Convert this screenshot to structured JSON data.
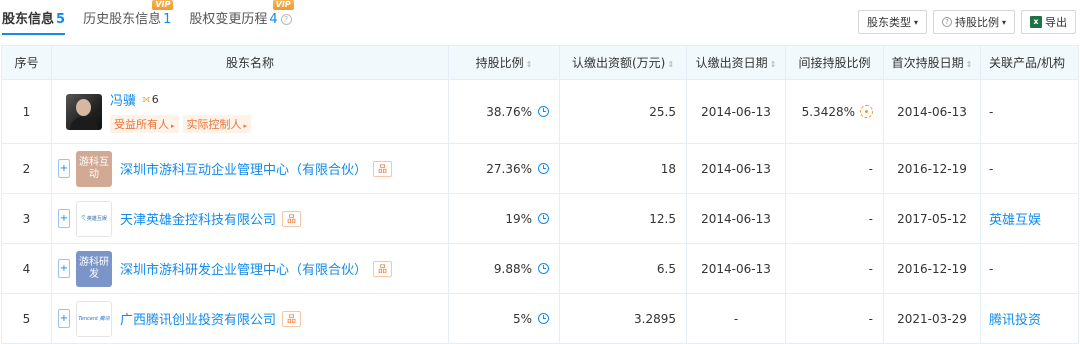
{
  "tabs": [
    {
      "label": "股东信息",
      "count": "5",
      "active": true,
      "vip": ""
    },
    {
      "label": "历史股东信息",
      "count": "1",
      "active": false,
      "vip": "VIP"
    },
    {
      "label": "股权变更历程",
      "count": "4",
      "active": false,
      "vip": "VIP"
    }
  ],
  "help_glyph": "?",
  "actions": {
    "shareholder_type": "股东类型",
    "holding_ratio": "持股比例",
    "export": "导出",
    "caret": "▾",
    "question_glyph": "?",
    "excel_glyph": "x"
  },
  "columns": [
    "序号",
    "股东名称",
    "持股比例",
    "认缴出资额(万元)",
    "认缴出资日期",
    "间接持股比例",
    "首次持股日期",
    "关联产品/机构"
  ],
  "sort_glyph": "⇕",
  "expand_glyph": "+",
  "equity_glyph": "品",
  "tag_arrow": "▸",
  "rows": [
    {
      "index": "1",
      "name": "冯骥",
      "holding_count": "6",
      "holding_glyph": "⟗",
      "tags": [
        "受益所有人",
        "实际控制人"
      ],
      "ratio": "38.76%",
      "amount": "25.5",
      "date": "2014-06-13",
      "indirect": "5.3428%",
      "first_date": "2014-06-13",
      "related": "-"
    },
    {
      "index": "2",
      "name": "深圳市游科互动企业管理中心（有限合伙）",
      "logo_text": "游科互动",
      "ratio": "27.36%",
      "amount": "18",
      "date": "2014-06-13",
      "indirect": "-",
      "first_date": "2016-12-19",
      "related": "-"
    },
    {
      "index": "3",
      "name": "天津英雄金控科技有限公司",
      "logo_text": "英雄互娱",
      "logo_mark": "ৎ",
      "ratio": "19%",
      "amount": "12.5",
      "date": "2014-06-13",
      "indirect": "-",
      "first_date": "2017-05-12",
      "related": "英雄互娱"
    },
    {
      "index": "4",
      "name": "深圳市游科研发企业管理中心（有限合伙）",
      "logo_text": "游科研发",
      "ratio": "9.88%",
      "amount": "6.5",
      "date": "2014-06-13",
      "indirect": "-",
      "first_date": "2016-12-19",
      "related": "-"
    },
    {
      "index": "5",
      "name": "广西腾讯创业投资有限公司",
      "logo_text": "Tencent 腾讯",
      "ratio": "5%",
      "amount": "3.2895",
      "date": "-",
      "indirect": "-",
      "first_date": "2021-03-29",
      "related": "腾讯投资"
    }
  ]
}
